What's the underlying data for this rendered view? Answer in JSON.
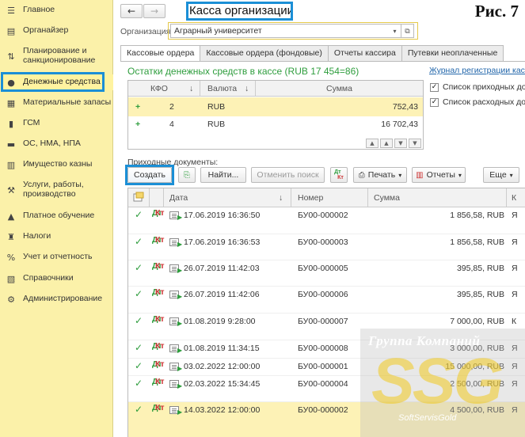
{
  "sidebar": {
    "items": [
      {
        "label": "Главное",
        "icon": "list-icon",
        "glyph": "☰"
      },
      {
        "label": "Органайзер",
        "icon": "clipboard-icon",
        "glyph": "▤"
      },
      {
        "label": "Планирование и\nсанкционирование",
        "icon": "chart-icon",
        "glyph": "⇅"
      },
      {
        "label": "Денежные средства",
        "icon": "coin-icon",
        "glyph": "●"
      },
      {
        "label": "Материальные запасы",
        "icon": "boxes-icon",
        "glyph": "▦"
      },
      {
        "label": "ГСМ",
        "icon": "fuel-icon",
        "glyph": "▮"
      },
      {
        "label": "ОС, НМА, НПА",
        "icon": "truck-icon",
        "glyph": "▬"
      },
      {
        "label": "Имущество казны",
        "icon": "building-icon",
        "glyph": "▥"
      },
      {
        "label": "Услуги, работы,\nпроизводство",
        "icon": "tools-icon",
        "glyph": "⚒"
      },
      {
        "label": "Платное обучение",
        "icon": "graduation-icon",
        "glyph": "▲"
      },
      {
        "label": "Налоги",
        "icon": "emblem-icon",
        "glyph": "♜"
      },
      {
        "label": "Учет и отчетность",
        "icon": "percent-icon",
        "glyph": "%"
      },
      {
        "label": "Справочники",
        "icon": "books-icon",
        "glyph": "▧"
      },
      {
        "label": "Администрирование",
        "icon": "gear-icon",
        "glyph": "⚙"
      }
    ]
  },
  "header": {
    "back_glyph": "←",
    "forward_glyph": "→",
    "title": "Касса организации",
    "figure_label": "Рис. 7"
  },
  "org": {
    "label": "Организация:",
    "value": "Аграрный университет",
    "dropdown_glyph": "▾",
    "open_glyph": "⧉"
  },
  "tabs": [
    {
      "label": "Кассовые ордера",
      "active": true
    },
    {
      "label": "Кассовые ордера (фондовые)",
      "active": false
    },
    {
      "label": "Отчеты кассира",
      "active": false
    },
    {
      "label": "Путевки неоплаченные",
      "active": false
    }
  ],
  "balance": {
    "title": "Остатки денежных средств в кассе (RUB 17 454=86)",
    "headers": {
      "kfo": "КФО",
      "kfo_sort": "↓",
      "currency": "Валюта",
      "currency_sort": "↓",
      "sum": "Сумма"
    },
    "rows": [
      {
        "plus": "+",
        "kfo": "2",
        "currency": "RUB",
        "sum": "752,43"
      },
      {
        "plus": "+",
        "kfo": "4",
        "currency": "RUB",
        "sum": "16 702,43"
      }
    ],
    "scroll_glyphs": [
      "▲",
      "▲",
      "▼",
      "▼"
    ]
  },
  "side_panel": {
    "journal_link": "Журнал регистрации касс",
    "check1": "Список приходных док",
    "check2": "Список расходных док",
    "check_glyph": "✓"
  },
  "docs": {
    "label": "Приходные документы:",
    "toolbar": {
      "create": "Создать",
      "copy_glyph": "⎘",
      "find": "Найти...",
      "cancel_search": "Отменить поиск",
      "dt": "Дт",
      "kt": "Кт",
      "print": "Печать",
      "print_glyph": "⎙",
      "reports": "Отчеты",
      "reports_glyph": "▥",
      "more": "Еще",
      "dd_glyph": "▾"
    },
    "headers": {
      "date": "Дата",
      "date_sort": "↓",
      "number": "Номер",
      "sum": "Сумма",
      "extra": "К"
    },
    "rows": [
      {
        "date": "17.06.2019 16:36:50",
        "number": "БУ00-000002",
        "sum": "1 856,58",
        "cur": "RUB",
        "extra": "Я",
        "posted": true
      },
      {
        "date": "17.06.2019 16:36:53",
        "number": "БУ00-000003",
        "sum": "1 856,58",
        "cur": "RUB",
        "extra": "Я",
        "posted": true
      },
      {
        "date": "26.07.2019 11:42:03",
        "number": "БУ00-000005",
        "sum": "395,85",
        "cur": "RUB",
        "extra": "Я",
        "posted": true
      },
      {
        "date": "26.07.2019 11:42:06",
        "number": "БУ00-000006",
        "sum": "395,85",
        "cur": "RUB",
        "extra": "Я",
        "posted": true
      },
      {
        "date": "01.08.2019 9:28:00",
        "number": "БУ00-000007",
        "sum": "7 000,00",
        "cur": "RUB",
        "extra": "К",
        "posted": true
      },
      {
        "date": "01.08.2019 11:34:15",
        "number": "БУ00-000008",
        "sum": "3 000,00",
        "cur": "RUB",
        "extra": "Я",
        "posted": true
      },
      {
        "date": "03.02.2022 12:00:00",
        "number": "БУ00-000001",
        "sum": "15 000,00",
        "cur": "RUB",
        "extra": "Я",
        "posted": true
      },
      {
        "date": "02.03.2022 15:34:45",
        "number": "БУ00-000004",
        "sum": "2 500,00",
        "cur": "RUB",
        "extra": "Я",
        "posted": true
      },
      {
        "date": "14.03.2022 12:00:00",
        "number": "БУ00-000002",
        "sum": "4 500,00",
        "cur": "RUB",
        "extra": "Я",
        "posted": true
      }
    ]
  },
  "watermark": {
    "line1": "Группа Компаний",
    "logo": "SSG",
    "line2": "SoftServisGold"
  },
  "colors": {
    "sidebar_bg": "#fbf1a9",
    "highlight_frame": "#1b8fd6",
    "title_green": "#2e9d3d",
    "selected_row": "#fdf2b6"
  }
}
